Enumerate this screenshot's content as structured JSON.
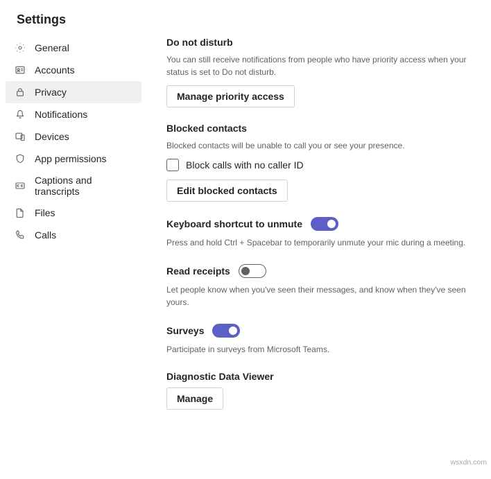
{
  "page": {
    "title": "Settings"
  },
  "sidebar": {
    "items": [
      {
        "label": "General"
      },
      {
        "label": "Accounts"
      },
      {
        "label": "Privacy"
      },
      {
        "label": "Notifications"
      },
      {
        "label": "Devices"
      },
      {
        "label": "App permissions"
      },
      {
        "label": "Captions and transcripts"
      },
      {
        "label": "Files"
      },
      {
        "label": "Calls"
      }
    ]
  },
  "sections": {
    "dnd": {
      "title": "Do not disturb",
      "desc": "You can still receive notifications from people who have priority access when your status is set to Do not disturb.",
      "button": "Manage priority access"
    },
    "blocked": {
      "title": "Blocked contacts",
      "desc": "Blocked contacts will be unable to call you or see your presence.",
      "checkbox_label": "Block calls with no caller ID",
      "button": "Edit blocked contacts"
    },
    "shortcut": {
      "title": "Keyboard shortcut to unmute",
      "desc": "Press and hold Ctrl + Spacebar to temporarily unmute your mic during a meeting.",
      "toggle": true
    },
    "read_receipts": {
      "title": "Read receipts",
      "desc": "Let people know when you've seen their messages, and know when they've seen yours.",
      "toggle": false
    },
    "surveys": {
      "title": "Surveys",
      "desc": "Participate in surveys from Microsoft Teams.",
      "toggle": true
    },
    "diagnostic": {
      "title": "Diagnostic Data Viewer",
      "button": "Manage"
    }
  },
  "watermark": "wsxdn.com"
}
